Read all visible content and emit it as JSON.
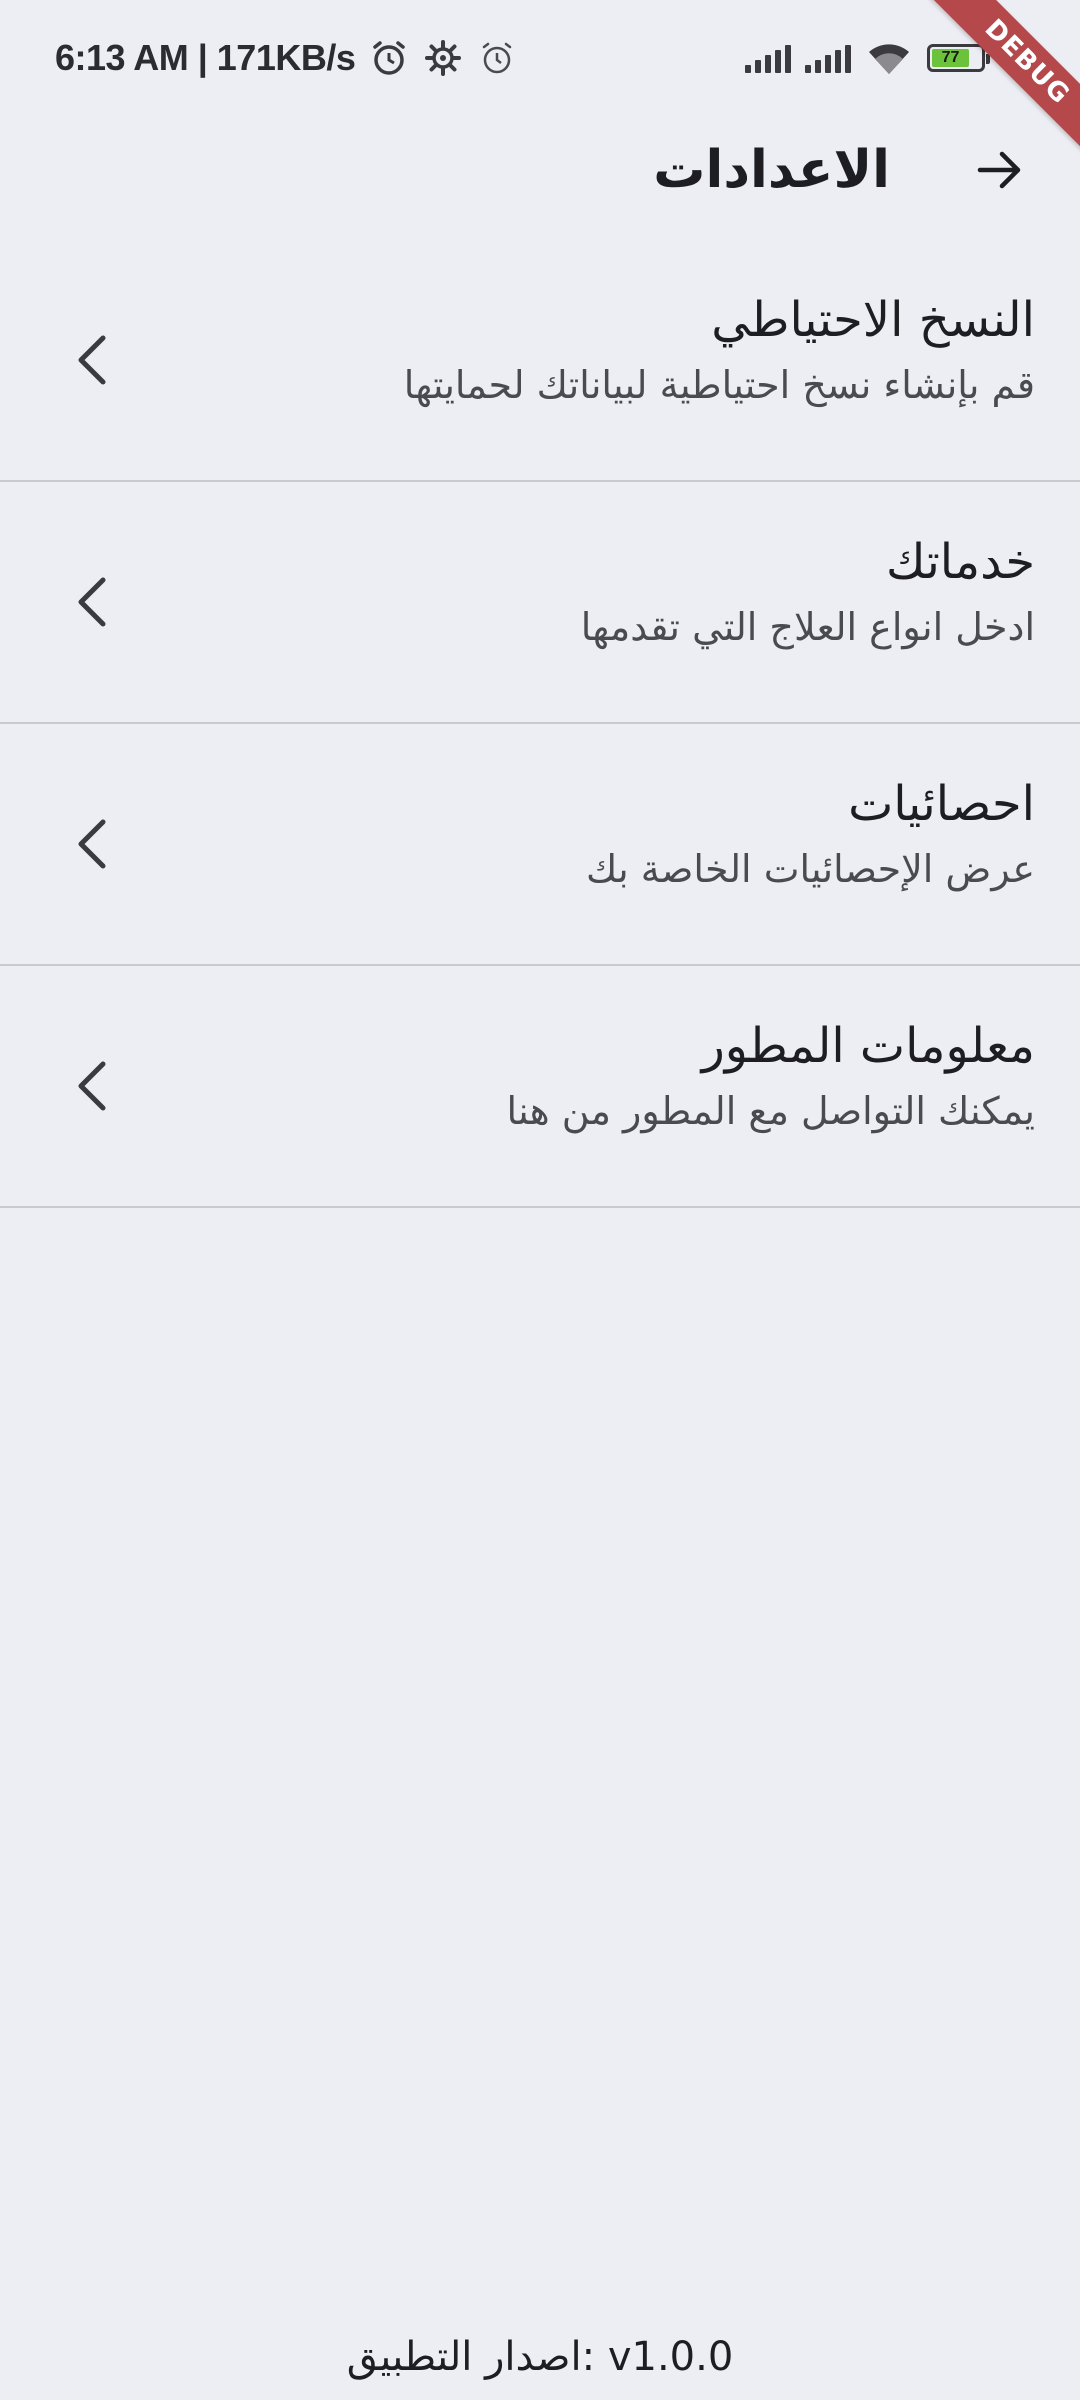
{
  "status_bar": {
    "time_speed": "6:13 AM | 171KB/s",
    "battery_level": "77",
    "icons": [
      "alarm-clock-icon",
      "gear-icon",
      "alarm-icon",
      "signal-icon",
      "wifi-icon",
      "battery-icon"
    ]
  },
  "debug_banner": "DEBUG",
  "app_bar": {
    "title": "الاعدادات",
    "back_icon": "arrow-right-icon"
  },
  "settings": {
    "items": [
      {
        "title": "النسخ الاحتياطي",
        "subtitle": "قم بإنشاء نسخ احتياطية لبياناتك لحمايتها"
      },
      {
        "title": "خدماتك",
        "subtitle": "ادخل انواع العلاج التي تقدمها"
      },
      {
        "title": "احصائيات",
        "subtitle": "عرض الإحصائيات الخاصة بك"
      },
      {
        "title": "معلومات المطور",
        "subtitle": "يمكنك التواصل مع المطور من هنا"
      }
    ]
  },
  "footer": {
    "version": "اصدار التطبيق: v1.0.0"
  },
  "colors": {
    "background": "#eceef3",
    "divider": "#c9cacf",
    "debug_banner": "#b5484b",
    "battery": "#6cc23a"
  }
}
